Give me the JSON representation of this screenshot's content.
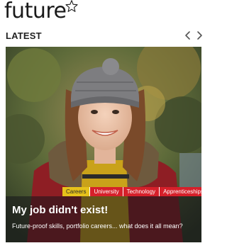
{
  "header": {
    "logo_text": "future",
    "logo_icon": "star-icon"
  },
  "section": {
    "title": "LATEST",
    "prev_icon": "chevron-left-icon",
    "next_icon": "chevron-right-icon"
  },
  "card": {
    "tags": [
      "Careers",
      "University",
      "Technology",
      "Apprenticeships"
    ],
    "headline": "My job didn't exist!",
    "subline": "Future-proof skills, portfolio careers... what does it all mean?"
  },
  "colors": {
    "tag_yellow": "#e6c21a",
    "tag_red": "#d6202a"
  }
}
